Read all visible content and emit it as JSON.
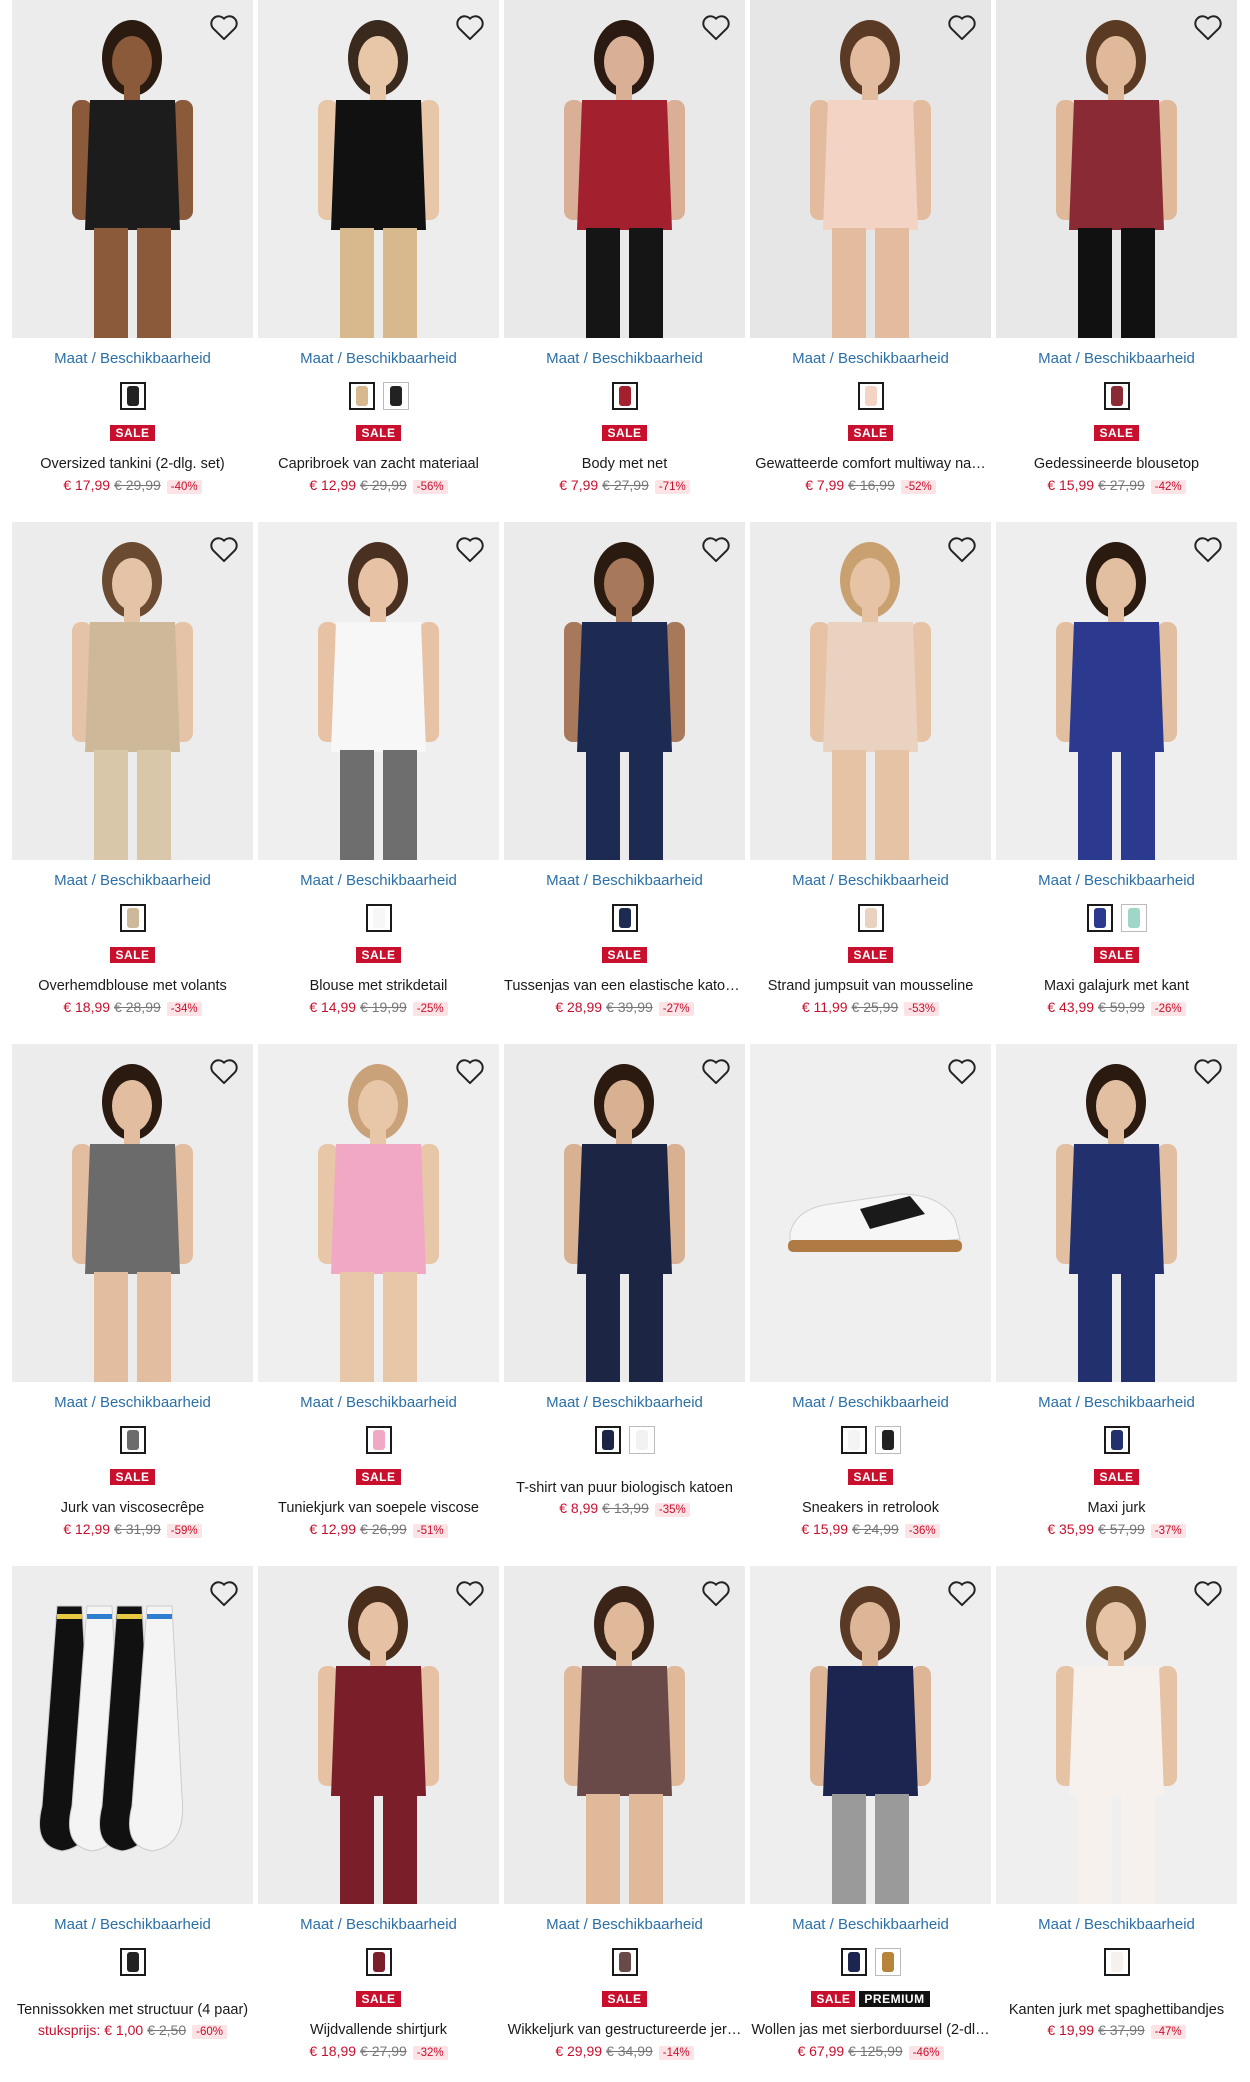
{
  "labels": {
    "size_link": "Maat / Beschikbaarheid"
  },
  "colors": {
    "sale": "#c8102e",
    "link": "#2b6fa8",
    "premium": "#111111"
  },
  "products": [
    {
      "name": "Oversized tankini (2-dlg. set)",
      "now": "€ 17,99",
      "was": "€ 29,99",
      "disc": "-40%",
      "badges": [
        "SALE"
      ],
      "swatches": [
        "#222222"
      ],
      "photo": {
        "bg": "#ececec",
        "body": "#1c1c1c",
        "skin": "#8a5a3b",
        "hair": "#2a1a10",
        "legs": "#8a5a3b"
      }
    },
    {
      "name": "Capribroek van zacht materiaal",
      "now": "€ 12,99",
      "was": "€ 29,99",
      "disc": "-56%",
      "badges": [
        "SALE"
      ],
      "swatches": [
        "#d8b98d",
        "#222222"
      ],
      "photo": {
        "bg": "#ededed",
        "body": "#111111",
        "skin": "#e8c6a8",
        "hair": "#3a2a1e",
        "legs": "#d8b98d"
      }
    },
    {
      "name": "Body met net",
      "now": "€ 7,99",
      "was": "€ 27,99",
      "disc": "-71%",
      "badges": [
        "SALE"
      ],
      "swatches": [
        "#a3202f"
      ],
      "photo": {
        "bg": "#e9e9e9",
        "body": "#a3202f",
        "skin": "#d9b096",
        "hair": "#2a1a12",
        "legs": "#151515"
      }
    },
    {
      "name": "Gewatteerde comfort multiway na…",
      "now": "€ 7,99",
      "was": "€ 16,99",
      "disc": "-52%",
      "badges": [
        "SALE"
      ],
      "swatches": [
        "#f2d3c4"
      ],
      "photo": {
        "bg": "#e6e6e6",
        "body": "#f2d3c4",
        "skin": "#e3bca0",
        "hair": "#5a3a24",
        "legs": "#e3bca0"
      }
    },
    {
      "name": "Gedessineerde blousetop",
      "now": "€ 15,99",
      "was": "€ 27,99",
      "disc": "-42%",
      "badges": [
        "SALE"
      ],
      "swatches": [
        "#8a2a35"
      ],
      "photo": {
        "bg": "#e8e8e8",
        "body": "#8a2a35",
        "skin": "#e0b89a",
        "hair": "#5a3a22",
        "legs": "#111111"
      }
    },
    {
      "name": "Overhemdblouse met volants",
      "now": "€ 18,99",
      "was": "€ 28,99",
      "disc": "-34%",
      "badges": [
        "SALE"
      ],
      "swatches": [
        "#cdb99a"
      ],
      "photo": {
        "bg": "#ececec",
        "body": "#cdb99a",
        "skin": "#e5c3a6",
        "hair": "#6a4a30",
        "legs": "#d8c7a8"
      }
    },
    {
      "name": "Blouse met strikdetail",
      "now": "€ 14,99",
      "was": "€ 19,99",
      "disc": "-25%",
      "badges": [
        "SALE"
      ],
      "swatches": [
        "#f7f7f7"
      ],
      "photo": {
        "bg": "#efefef",
        "body": "#f7f7f7",
        "skin": "#e8c2a4",
        "hair": "#4a3020",
        "legs": "#6e6e6e"
      }
    },
    {
      "name": "Tussenjas van een elastische katoe…",
      "now": "€ 28,99",
      "was": "€ 39,99",
      "disc": "-27%",
      "badges": [
        "SALE"
      ],
      "swatches": [
        "#1d2a52"
      ],
      "photo": {
        "bg": "#ebebeb",
        "body": "#1d2a52",
        "skin": "#a8785a",
        "hair": "#2a1a10",
        "legs": "#1d2a52"
      }
    },
    {
      "name": "Strand jumpsuit van mousseline",
      "now": "€ 11,99",
      "was": "€ 25,99",
      "disc": "-53%",
      "badges": [
        "SALE"
      ],
      "swatches": [
        "#ead2c0"
      ],
      "photo": {
        "bg": "#ececec",
        "body": "#ead2c0",
        "skin": "#e7c3a5",
        "hair": "#c9a070",
        "legs": "#e7c3a5"
      }
    },
    {
      "name": "Maxi galajurk met kant",
      "now": "€ 43,99",
      "was": "€ 59,99",
      "disc": "-26%",
      "badges": [
        "SALE"
      ],
      "swatches": [
        "#2b3a8e",
        "#9fd6c8"
      ],
      "photo": {
        "bg": "#eeeeee",
        "body": "#2b3a8e",
        "skin": "#e3bfa1",
        "hair": "#2a1a10",
        "legs": "#2b3a8e"
      }
    },
    {
      "name": "Jurk van viscosecrêpe",
      "now": "€ 12,99",
      "was": "€ 31,99",
      "disc": "-59%",
      "badges": [
        "SALE"
      ],
      "swatches": [
        "#6b6b6b"
      ],
      "photo": {
        "bg": "#ececec",
        "body": "#6b6b6b",
        "skin": "#e2bd9f",
        "hair": "#2a1a10",
        "legs": "#e2bd9f"
      }
    },
    {
      "name": "Tuniekjurk van soepele viscose",
      "now": "€ 12,99",
      "was": "€ 26,99",
      "disc": "-51%",
      "badges": [
        "SALE"
      ],
      "swatches": [
        "#f0a8c4"
      ],
      "photo": {
        "bg": "#efefef",
        "body": "#f0a8c4",
        "skin": "#e8c6a8",
        "hair": "#c9a27a",
        "legs": "#e8c6a8"
      }
    },
    {
      "name": "T-shirt van puur biologisch katoen",
      "now": "€ 8,99",
      "was": "€ 13,99",
      "disc": "-35%",
      "badges": [],
      "swatches": [
        "#1d2544",
        "#f2f2f2"
      ],
      "photo": {
        "bg": "#ebebeb",
        "body": "#1d2544",
        "skin": "#d8b092",
        "hair": "#2a1a10",
        "legs": "#1d2544"
      }
    },
    {
      "name": "Sneakers in retrolook",
      "now": "€ 15,99",
      "was": "€ 24,99",
      "disc": "-36%",
      "badges": [
        "SALE"
      ],
      "swatches": [
        "#f4f4f4",
        "#222222"
      ],
      "photo": {
        "bg": "#efefef",
        "shoe": true
      }
    },
    {
      "name": "Maxi jurk",
      "now": "€ 35,99",
      "was": "€ 57,99",
      "disc": "-37%",
      "badges": [
        "SALE"
      ],
      "swatches": [
        "#22306e"
      ],
      "photo": {
        "bg": "#eeeeee",
        "body": "#22306e",
        "skin": "#e3bfa1",
        "hair": "#2a1a10",
        "legs": "#22306e"
      }
    },
    {
      "name": "Tennissokken met structuur (4 paar)",
      "unit": "stuksprijs:",
      "now": "€ 1,00",
      "was": "€ 2,50",
      "disc": "-60%",
      "badges": [],
      "swatches": [
        "#222222"
      ],
      "photo": {
        "bg": "#ededed",
        "socks": true
      }
    },
    {
      "name": "Wijdvallende shirtjurk",
      "now": "€ 18,99",
      "was": "€ 27,99",
      "disc": "-32%",
      "badges": [
        "SALE"
      ],
      "swatches": [
        "#7a1e2a"
      ],
      "photo": {
        "bg": "#ececec",
        "body": "#7a1e2a",
        "skin": "#e6c1a3",
        "hair": "#4a2e1c",
        "legs": "#7a1e2a"
      }
    },
    {
      "name": "Wikkeljurk van gestructureerde jer…",
      "now": "€ 29,99",
      "was": "€ 34,99",
      "disc": "-14%",
      "badges": [
        "SALE"
      ],
      "swatches": [
        "#6a4a48"
      ],
      "photo": {
        "bg": "#ebebeb",
        "body": "#6a4a48",
        "skin": "#e0b99b",
        "hair": "#3a2418",
        "legs": "#e0b99b"
      }
    },
    {
      "name": "Wollen jas met sierborduursel (2-dl…",
      "now": "€ 67,99",
      "was": "€ 125,99",
      "disc": "-46%",
      "badges": [
        "SALE",
        "PREMIUM"
      ],
      "swatches": [
        "#1b2550",
        "#b8843a"
      ],
      "photo": {
        "bg": "#eeeeee",
        "body": "#1b2550",
        "skin": "#ddb597",
        "hair": "#5a3a24",
        "legs": "#9a9a9a"
      }
    },
    {
      "name": "Kanten jurk met spaghettibandjes",
      "now": "€ 19,99",
      "was": "€ 37,99",
      "disc": "-47%",
      "badges": [],
      "swatches": [
        "#f6f1ec"
      ],
      "photo": {
        "bg": "#efefef",
        "body": "#f6f1ec",
        "skin": "#e6c3a5",
        "hair": "#6a4a2c",
        "legs": "#f6f1ec"
      }
    }
  ]
}
